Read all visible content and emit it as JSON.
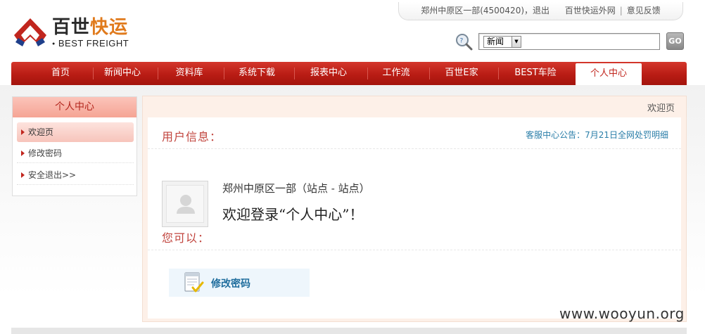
{
  "brand": {
    "name_cn_part1": "百世",
    "name_cn_part2": "快运",
    "name_en": "BEST FREIGHT"
  },
  "toplinks": {
    "user": "郑州中原区一部(4500420)",
    "logout": "退出",
    "extranet": "百世快运外网",
    "feedback": "意见反馈",
    "comma": "，"
  },
  "search": {
    "category": "新闻",
    "value": "",
    "go_label": "GO"
  },
  "nav": {
    "items": [
      "首页",
      "新闻中心",
      "资料库",
      "系统下载",
      "报表中心",
      "工作流",
      "百世E家",
      "BEST车险",
      "个人中心"
    ],
    "active": "个人中心"
  },
  "sidebar": {
    "title": "个人中心",
    "items": [
      "欢迎页",
      "修改密码",
      "安全退出>>"
    ]
  },
  "main": {
    "breadcrumb": "欢迎页",
    "user_info_title": "用户信息：",
    "notice": "客服中心公告：7月21日全网处罚明细",
    "station": "郑州中原区一部（站点 - 站点）",
    "welcome": "欢迎登录“个人中心”！",
    "you_can": "您可以：",
    "action_label": "修改密码"
  },
  "watermark": "www.wooyun.org",
  "colors": {
    "brand_red": "#c1261e",
    "brand_orange": "#e07a1c",
    "link_blue": "#2a7ea8"
  }
}
